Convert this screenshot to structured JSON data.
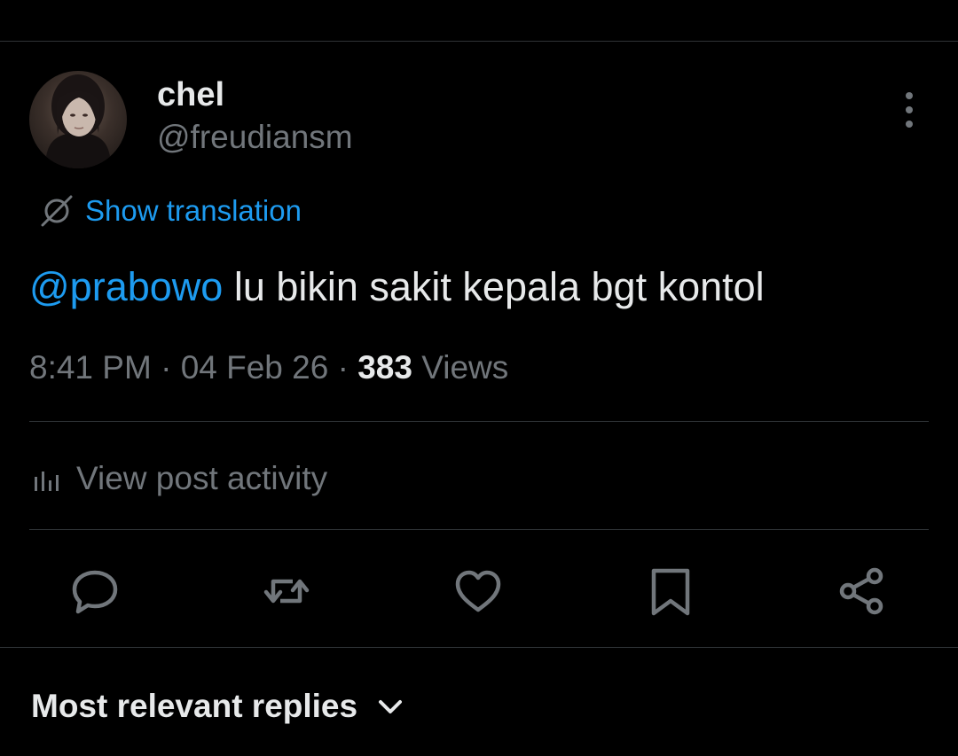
{
  "post": {
    "author_name": "chel",
    "author_handle": "@freudiansm",
    "translation_label": "Show translation",
    "text_mention": "@prabowo",
    "text_body": " lu bikin sakit kepala bgt kontol",
    "time": "8:41 PM",
    "date": "04 Feb 26",
    "views_count": "383",
    "views_label": "Views",
    "activity_label": "View post activity"
  },
  "actions": [
    {
      "icon": "reply-icon"
    },
    {
      "icon": "repost-icon"
    },
    {
      "icon": "like-icon"
    },
    {
      "icon": "bookmark-icon"
    },
    {
      "icon": "share-icon"
    }
  ],
  "replies": {
    "sort_label": "Most relevant replies"
  },
  "colors": {
    "background": "#000000",
    "text_primary": "#e7e9ea",
    "text_secondary": "#71767b",
    "accent": "#1d9bf0",
    "divider": "#2f3336"
  }
}
